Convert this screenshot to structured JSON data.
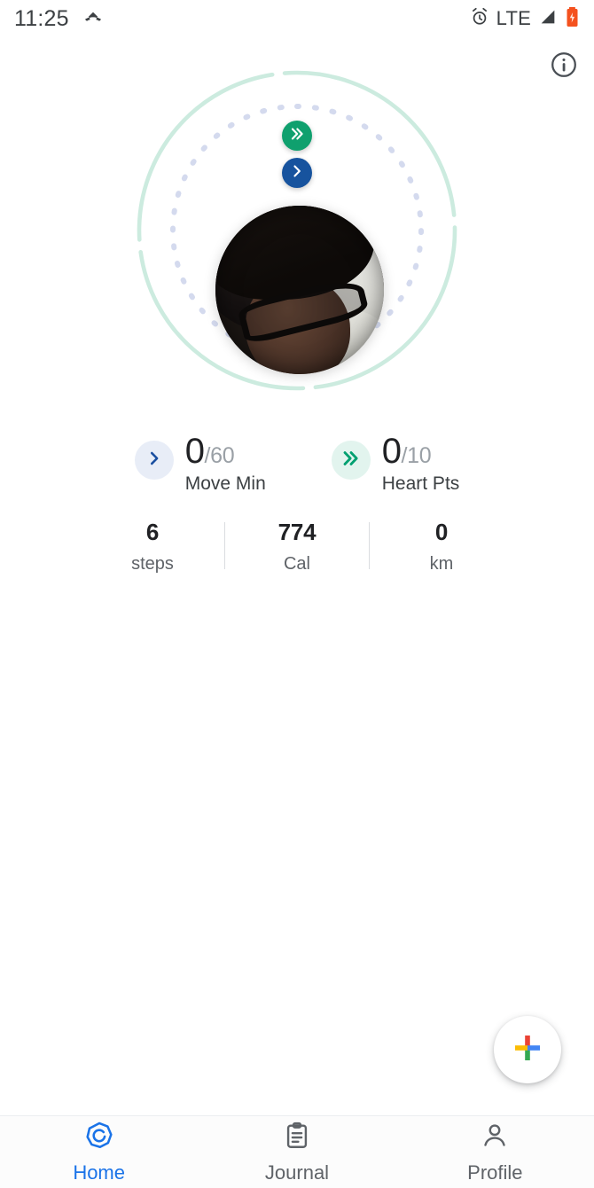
{
  "status_bar": {
    "time": "11:25",
    "icons": [
      "missed-call-icon",
      "alarm-icon",
      "signal-icon",
      "battery-charging-icon"
    ],
    "network_label": "LTE",
    "battery_color": "#F4511E",
    "text_color": "#3c4043"
  },
  "header": {
    "info_icon": "info-circle-icon"
  },
  "rings": {
    "outer_ring": {
      "name": "heart-points-ring",
      "color": "#CCEBDF",
      "progress": 0,
      "style": "segmented"
    },
    "inner_ring": {
      "name": "move-minutes-ring",
      "color": "#D4DAEE",
      "progress": 0,
      "style": "dashed"
    },
    "badge_green": {
      "icon": "double-chevron-icon",
      "color": "#0FA06E"
    },
    "badge_blue": {
      "icon": "chevron-right-icon",
      "color": "#17539E"
    },
    "avatar": {
      "name": "user-profile-photo",
      "alt": "Profile photo of user"
    }
  },
  "goals": [
    {
      "icon": "chevron-right-icon",
      "icon_color": "#1A4FA0",
      "icon_bg": "#E8EDF7",
      "value": "0",
      "denominator": "/60",
      "label": "Move Min"
    },
    {
      "icon": "double-chevron-icon",
      "icon_color": "#00A070",
      "icon_bg": "#E2F4EE",
      "value": "0",
      "denominator": "/10",
      "label": "Heart Pts"
    }
  ],
  "metrics": [
    {
      "value": "6",
      "label": "steps"
    },
    {
      "value": "774",
      "label": "Cal"
    },
    {
      "value": "0",
      "label": "km"
    }
  ],
  "fab": {
    "name": "add-activity-button",
    "icon": "google-plus-icon",
    "colors": {
      "red": "#EA4335",
      "blue": "#4285F4",
      "green": "#34A853",
      "yellow": "#FBBC04"
    }
  },
  "bottom_nav": {
    "active": "Home",
    "items": [
      {
        "label": "Home",
        "icon": "fit-heptagon-icon",
        "active": true
      },
      {
        "label": "Journal",
        "icon": "clipboard-icon",
        "active": false
      },
      {
        "label": "Profile",
        "icon": "person-icon",
        "active": false
      }
    ]
  },
  "accent_color": "#1A73E8"
}
